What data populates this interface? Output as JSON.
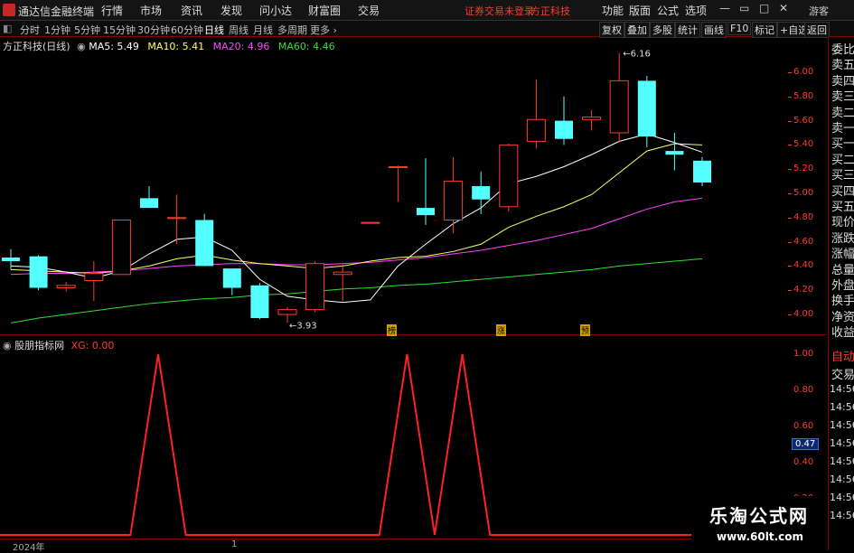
{
  "titlebar": {
    "app_name": "通达信金融终端",
    "menus": [
      "行情",
      "市场",
      "资讯",
      "发现",
      "问小达",
      "财富圈",
      "交易"
    ],
    "warning": "证券交易未登录",
    "broker": "方正科技",
    "right_menus": [
      "功能",
      "版面",
      "公式",
      "选项"
    ],
    "guest": "游客"
  },
  "toolbar": {
    "periods": [
      "分时",
      "1分钟",
      "5分钟",
      "15分钟",
      "30分钟",
      "60分钟",
      "日线",
      "周线",
      "月线",
      "多周期",
      "更多 ›"
    ],
    "active_period": "日线",
    "right_buttons": [
      "复权",
      "叠加",
      "多股",
      "统计",
      "画线",
      "F10",
      "标记",
      "+自选",
      "返回"
    ]
  },
  "chart_header": {
    "stock": "方正科技(日线)",
    "ma5": "MA5: 5.49",
    "ma10": "MA10: 5.41",
    "ma20": "MA20: 4.96",
    "ma60": "MA60: 4.46"
  },
  "colors": {
    "up": "#ff3b30",
    "down": "#54ffff",
    "ma5": "#ffffff",
    "ma10": "#ffff66",
    "ma20": "#ff44ff",
    "ma60": "#33dd33",
    "indicator": "#ff2020"
  },
  "price_axis": [
    "6.00",
    "5.80",
    "5.60",
    "5.40",
    "5.20",
    "5.00",
    "4.80",
    "4.60",
    "4.40",
    "4.20",
    "4.00"
  ],
  "annotations": {
    "high": "6.16",
    "low": "3.93"
  },
  "markers": [
    "榜",
    "涨",
    "预"
  ],
  "right_column": {
    "top": [
      "委比",
      "卖五",
      "卖四",
      "卖三",
      "卖二",
      "卖一",
      "买一",
      "买二",
      "买三",
      "买四",
      "买五",
      "现价",
      "涨跌",
      "涨幅",
      "总量",
      "外盘",
      "换手",
      "净资",
      "收益"
    ],
    "bottom": [
      "自动",
      "交易",
      "14:56",
      "14:56",
      "14:56",
      "14:56",
      "14:56",
      "14:56",
      "14:56",
      "14:56"
    ]
  },
  "indicator": {
    "name": "股朋指标网",
    "value_label": "XG: 0.00",
    "axis": [
      "1.00",
      "0.80",
      "0.60",
      "0.40",
      "0.20"
    ],
    "current": "0.47"
  },
  "bottom_bar": {
    "year": "2024年",
    "mark": "1"
  },
  "watermark": {
    "line1": "乐淘公式网",
    "line2": "www.60lt.com"
  },
  "chart_data": [
    {
      "type": "candlestick",
      "title": "方正科技(日线)",
      "ylim": [
        3.9,
        6.2
      ],
      "candles": [
        {
          "o": 4.47,
          "h": 4.54,
          "l": 4.37,
          "c": 4.44
        },
        {
          "o": 4.48,
          "h": 4.49,
          "l": 4.2,
          "c": 4.22
        },
        {
          "o": 4.22,
          "h": 4.27,
          "l": 4.19,
          "c": 4.24
        },
        {
          "o": 4.28,
          "h": 4.44,
          "l": 4.11,
          "c": 4.34
        },
        {
          "o": 4.33,
          "h": 4.78,
          "l": 4.33,
          "c": 4.78
        },
        {
          "o": 4.96,
          "h": 5.06,
          "l": 4.88,
          "c": 4.88
        },
        {
          "o": 4.8,
          "h": 4.99,
          "l": 4.58,
          "c": 4.8
        },
        {
          "o": 4.78,
          "h": 4.83,
          "l": 4.4,
          "c": 4.4
        },
        {
          "o": 4.38,
          "h": 4.38,
          "l": 4.16,
          "c": 4.22
        },
        {
          "o": 4.24,
          "h": 4.26,
          "l": 3.96,
          "c": 3.97
        },
        {
          "o": 4.0,
          "h": 4.06,
          "l": 3.93,
          "c": 4.04
        },
        {
          "o": 4.04,
          "h": 4.44,
          "l": 4.02,
          "c": 4.42
        },
        {
          "o": 4.33,
          "h": 4.42,
          "l": 4.11,
          "c": 4.35
        },
        {
          "o": 4.76,
          "h": 4.76,
          "l": 4.76,
          "c": 4.76
        },
        {
          "o": 5.22,
          "h": 5.23,
          "l": 4.93,
          "c": 5.22
        },
        {
          "o": 4.88,
          "h": 5.29,
          "l": 4.74,
          "c": 4.82
        },
        {
          "o": 4.78,
          "h": 5.3,
          "l": 4.67,
          "c": 5.1
        },
        {
          "o": 5.06,
          "h": 5.18,
          "l": 4.83,
          "c": 4.95
        },
        {
          "o": 4.89,
          "h": 5.41,
          "l": 4.85,
          "c": 5.4
        },
        {
          "o": 5.43,
          "h": 5.94,
          "l": 5.37,
          "c": 5.61
        },
        {
          "o": 5.6,
          "h": 5.8,
          "l": 5.4,
          "c": 5.45
        },
        {
          "o": 5.61,
          "h": 5.69,
          "l": 5.52,
          "c": 5.63
        },
        {
          "o": 5.5,
          "h": 6.16,
          "l": 5.42,
          "c": 5.93
        },
        {
          "o": 5.93,
          "h": 5.97,
          "l": 5.38,
          "c": 5.47
        },
        {
          "o": 5.35,
          "h": 5.5,
          "l": 5.19,
          "c": 5.32
        },
        {
          "o": 5.27,
          "h": 5.3,
          "l": 5.06,
          "c": 5.09
        }
      ],
      "ma5": [
        4.4,
        4.39,
        4.35,
        4.3,
        4.36,
        4.5,
        4.62,
        4.64,
        4.53,
        4.29,
        4.15,
        4.12,
        4.1,
        4.12,
        4.4,
        4.58,
        4.75,
        4.88,
        5.08,
        5.14,
        5.22,
        5.32,
        5.43,
        5.49,
        5.42,
        5.34
      ],
      "ma10": [
        4.37,
        4.36,
        4.35,
        4.34,
        4.36,
        4.4,
        4.46,
        4.49,
        4.45,
        4.42,
        4.4,
        4.38,
        4.4,
        4.44,
        4.47,
        4.48,
        4.52,
        4.58,
        4.72,
        4.81,
        4.89,
        4.99,
        5.17,
        5.35,
        5.41,
        5.4
      ],
      "ma20": [
        4.33,
        4.34,
        4.34,
        4.35,
        4.36,
        4.38,
        4.4,
        4.41,
        4.42,
        4.42,
        4.41,
        4.41,
        4.42,
        4.43,
        4.45,
        4.47,
        4.5,
        4.53,
        4.57,
        4.61,
        4.66,
        4.71,
        4.79,
        4.87,
        4.93,
        4.96
      ],
      "ma60": [
        3.93,
        3.97,
        4.0,
        4.03,
        4.06,
        4.09,
        4.11,
        4.13,
        4.14,
        4.16,
        4.17,
        4.19,
        4.21,
        4.22,
        4.24,
        4.25,
        4.27,
        4.29,
        4.31,
        4.33,
        4.35,
        4.37,
        4.4,
        4.42,
        4.44,
        4.46
      ]
    },
    {
      "type": "line",
      "title": "股朋指标网",
      "series": [
        {
          "name": "XG",
          "values": [
            0,
            0,
            0,
            0,
            0,
            1,
            0,
            0,
            0,
            0,
            0,
            0,
            0,
            0,
            1,
            0,
            1,
            0,
            0,
            0,
            0,
            0,
            0,
            0,
            0,
            0,
            0
          ]
        }
      ],
      "ylim": [
        0,
        1.05
      ]
    }
  ]
}
